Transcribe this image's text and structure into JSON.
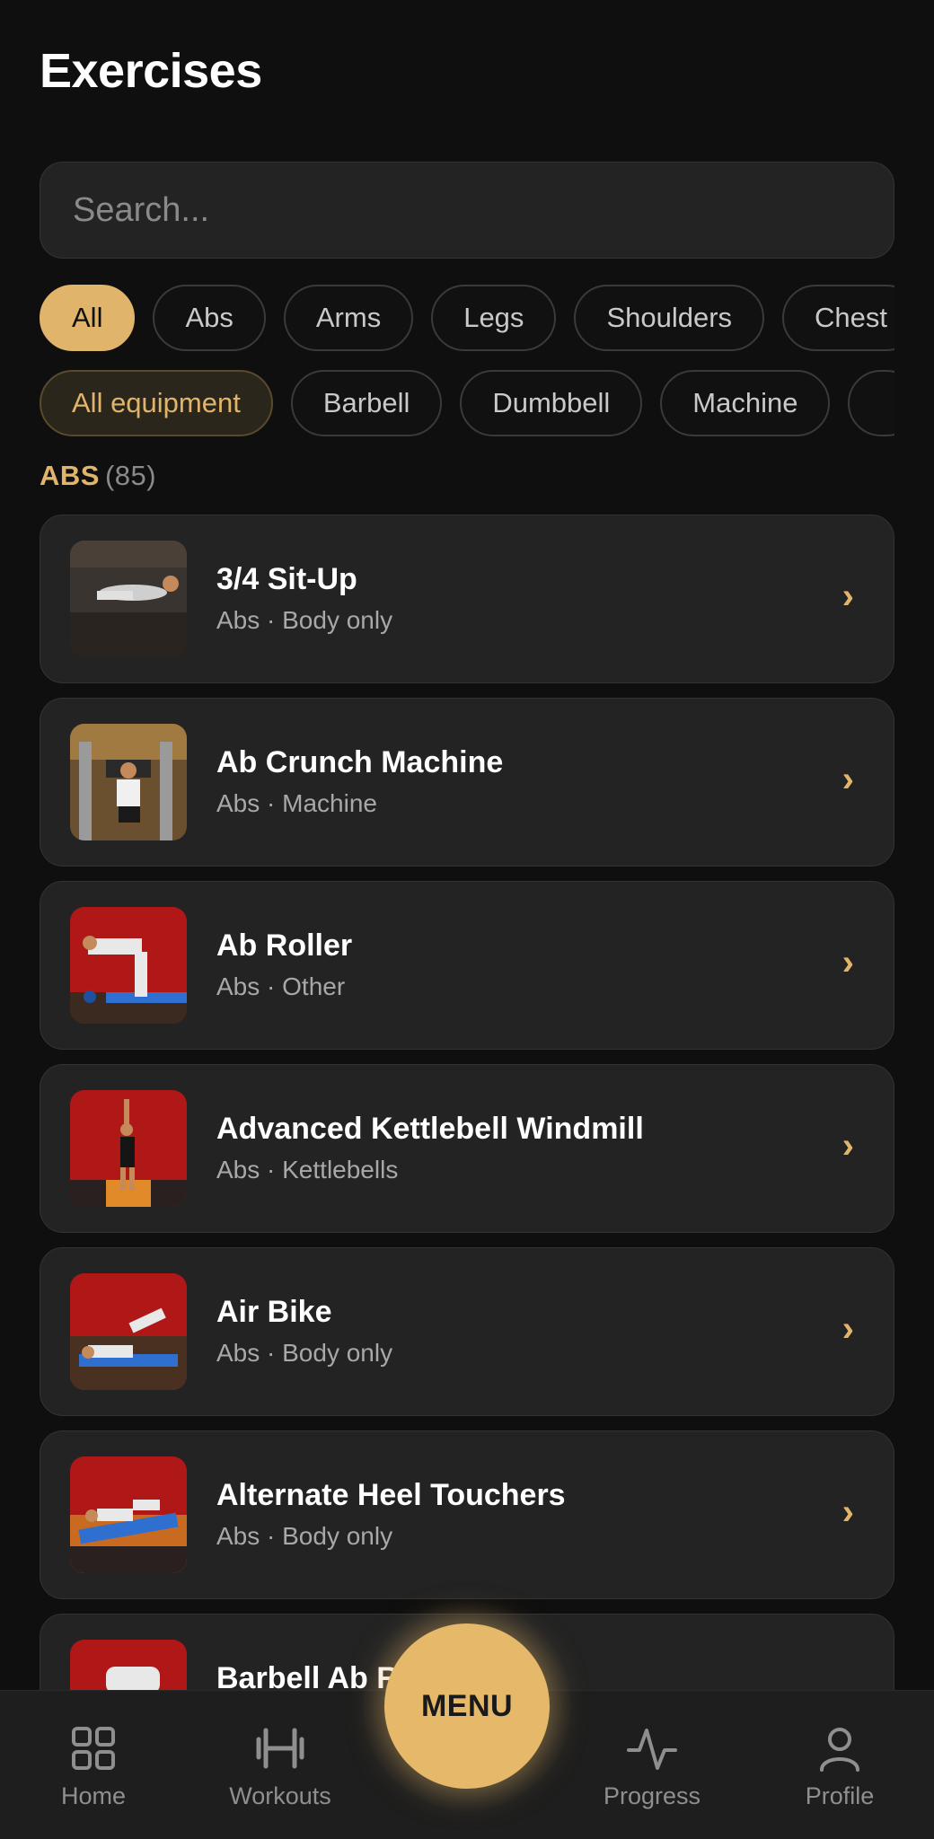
{
  "header": {
    "title": "Exercises"
  },
  "search": {
    "placeholder": "Search..."
  },
  "filters": {
    "categories": [
      "All",
      "Abs",
      "Arms",
      "Legs",
      "Shoulders",
      "Chest"
    ],
    "equipment": [
      "All equipment",
      "Barbell",
      "Dumbbell",
      "Machine",
      ""
    ]
  },
  "section": {
    "name": "ABS",
    "count": "(85)"
  },
  "exercises": [
    {
      "name": "3/4 Sit-Up",
      "meta": "Abs · Body only"
    },
    {
      "name": "Ab Crunch Machine",
      "meta": "Abs · Machine"
    },
    {
      "name": "Ab Roller",
      "meta": "Abs · Other"
    },
    {
      "name": "Advanced Kettlebell Windmill",
      "meta": "Abs · Kettlebells"
    },
    {
      "name": "Air Bike",
      "meta": "Abs · Body only"
    },
    {
      "name": "Alternate Heel Touchers",
      "meta": "Abs · Body only"
    },
    {
      "name": "Barbell Ab R",
      "meta": ""
    }
  ],
  "chevron": "›",
  "nav": {
    "home": "Home",
    "workouts": "Workouts",
    "menu": "MENU",
    "progress": "Progress",
    "profile": "Profile"
  },
  "colors": {
    "accent": "#e0b46a",
    "background": "#0f0f0f",
    "card": "#232323"
  },
  "icons": {
    "home": "grid-icon",
    "workouts": "dumbbell-icon",
    "progress": "activity-icon",
    "profile": "user-icon"
  }
}
